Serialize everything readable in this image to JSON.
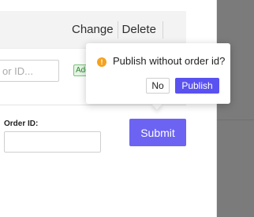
{
  "header": {
    "change_label": "Change",
    "delete_label": "Delete"
  },
  "search": {
    "placeholder": "or ID...",
    "add_chip_text": "Add"
  },
  "order": {
    "label": "Order ID:",
    "value": "",
    "submit_label": "Submit"
  },
  "popconfirm": {
    "icon": "exclamation-warning-icon",
    "message": "Publish without order id?",
    "cancel_label": "No",
    "confirm_label": "Publish"
  },
  "colors": {
    "accent": "#6c63f2",
    "confirm": "#5a52f0",
    "warning": "#f4a21f",
    "overlay": "#7b7b7b"
  }
}
